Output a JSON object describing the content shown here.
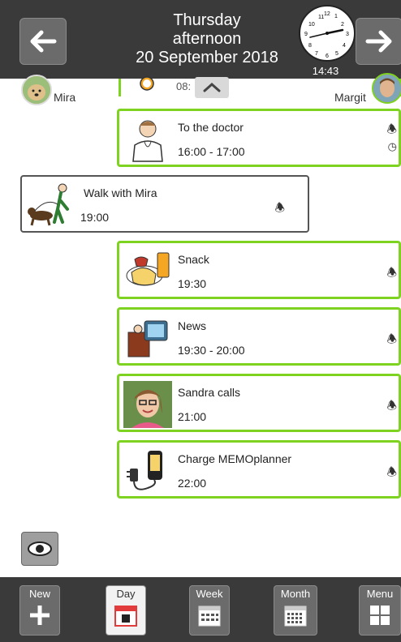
{
  "header": {
    "day": "Thursday",
    "period": "afternoon",
    "date": "20 September 2018",
    "clock_time": "14:43",
    "clock_numbers": [
      "11",
      "12",
      "1",
      "10",
      "2",
      "9",
      "3",
      "8",
      "4",
      "7",
      "6",
      "5"
    ]
  },
  "people": {
    "left_name": "Mira",
    "right_name": "Margit"
  },
  "partial_activity": {
    "time": "08:"
  },
  "activities": [
    {
      "title": "To the doctor",
      "time": "16:00 - 17:00",
      "icon": "doctor-icon"
    },
    {
      "title": "Walk with Mira",
      "time": "19:00",
      "icon": "dog-walk-icon"
    },
    {
      "title": "Snack",
      "time": "19:30",
      "icon": "snack-icon"
    },
    {
      "title": "News",
      "time": "19:30 - 20:00",
      "icon": "tv-icon"
    },
    {
      "title": "Sandra calls",
      "time": "21:00",
      "icon": "photo-icon"
    },
    {
      "title": "Charge MEMOplanner",
      "time": "22:00",
      "icon": "charger-icon"
    }
  ],
  "bottom_nav": [
    {
      "label": "New",
      "icon": "plus-icon"
    },
    {
      "label": "Day",
      "icon": "calendar-day-icon"
    },
    {
      "label": "Week",
      "icon": "calendar-week-icon"
    },
    {
      "label": "Month",
      "icon": "calendar-month-icon"
    },
    {
      "label": "Menu",
      "icon": "grid-icon"
    }
  ],
  "colors": {
    "bar": "#3a3a3a",
    "accent_green": "#7ed321",
    "button": "#6b6b6b"
  }
}
